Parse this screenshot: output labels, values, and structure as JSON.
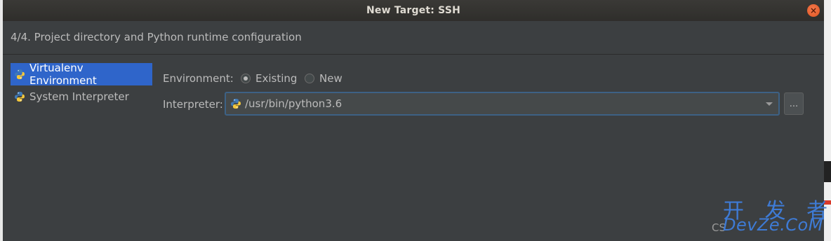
{
  "window": {
    "title": "New Target: SSH",
    "close_icon": "close-icon"
  },
  "step_header": "4/4. Project directory and Python runtime configuration",
  "sidebar": {
    "items": [
      {
        "label": "Virtualenv Environment",
        "icon": "python-icon",
        "selected": true
      },
      {
        "label": "System Interpreter",
        "icon": "python-icon",
        "selected": false
      }
    ]
  },
  "environment": {
    "label": "Environment:",
    "options": [
      {
        "label": "Existing",
        "checked": true
      },
      {
        "label": "New",
        "checked": false
      }
    ]
  },
  "interpreter": {
    "label": "Interpreter:",
    "value": "/usr/bin/python3.6",
    "browse_label": "..."
  },
  "watermark": {
    "chinese": "开 发 者",
    "site": "DevZe.CoM",
    "csdn": "CS"
  },
  "colors": {
    "background": "#3c3f41",
    "selection": "#2f65ca",
    "focus_border": "#3d6185",
    "close_button": "#e05420",
    "watermark": "#3e7bd6"
  }
}
